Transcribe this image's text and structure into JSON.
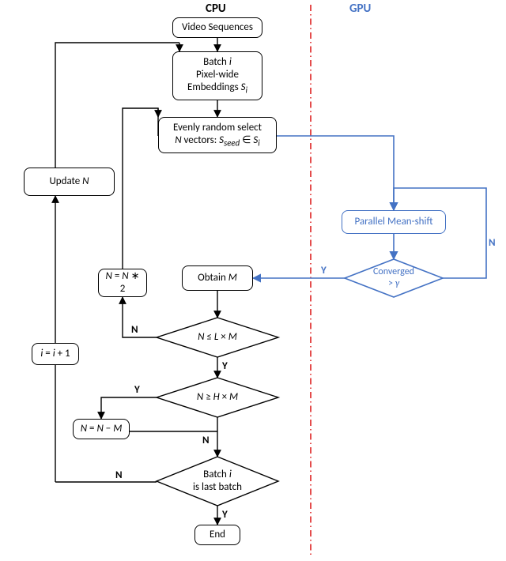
{
  "section_cpu": "CPU",
  "section_gpu": "GPU",
  "nodes": {
    "start": "Video Sequences",
    "batch": "Batch <span class='ital'>i</span><br>Pixel-wide<br>Embeddings <span class='ital'>S<sub>i</sub></span>",
    "select": "Evenly random select<br><span class='ital'>N</span> vectors: <span class='ital'>S<sub>seed</sub></span> ∈ <span class='ital'>S<sub>i</sub></span>",
    "updateN": "Update <span class='ital'>N</span>",
    "meanshift": "Parallel Mean-shift",
    "converged": "Converged<br>&gt; <span class='ital'>γ</span>",
    "obtainM": "Obtain <span class='ital'>M</span>",
    "n2": "<span class='ital'>N</span> = <span class='ital'>N</span> ∗ 2",
    "condL": "<span class='ital'>N</span> ≤ <span class='ital'>L</span> × <span class='ital'>M</span>",
    "condH": "<span class='ital'>N</span> ≥ <span class='ital'>H</span> × <span class='ital'>M</span>",
    "nMinus": "<span class='ital'>N</span> = <span class='ital'>N</span> − <span class='ital'>M</span>",
    "last": "Batch <span class='ital'>i</span><br>is last batch",
    "inc": "<span class='ital'>i</span> = <span class='ital'>i</span> + 1",
    "end": "End"
  },
  "yn": {
    "Y": "Y",
    "N": "N"
  }
}
